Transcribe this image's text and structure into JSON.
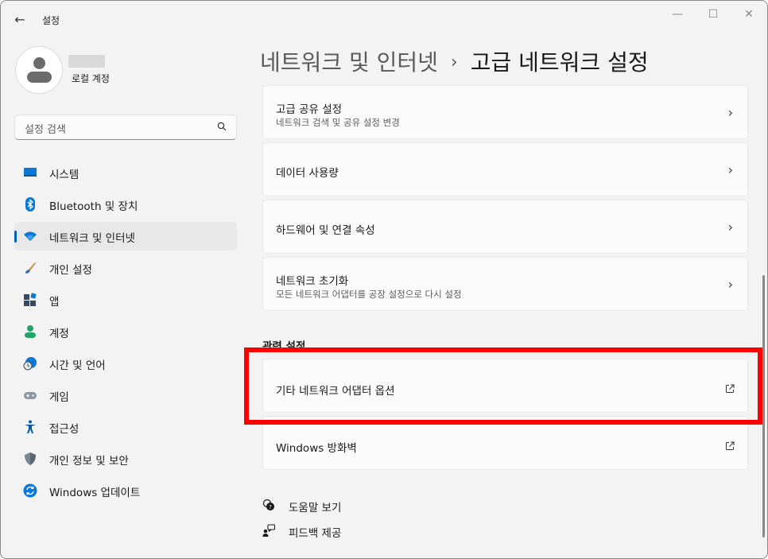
{
  "app": {
    "title": "설정"
  },
  "user": {
    "account_label": "로컬 계정"
  },
  "search": {
    "placeholder": "설정 검색"
  },
  "nav": [
    {
      "label": "시스템",
      "icon": "system-icon"
    },
    {
      "label": "Bluetooth 및 장치",
      "icon": "bluetooth-icon"
    },
    {
      "label": "네트워크 및 인터넷",
      "icon": "wifi-icon",
      "active": true
    },
    {
      "label": "개인 설정",
      "icon": "brush-icon"
    },
    {
      "label": "앱",
      "icon": "apps-icon"
    },
    {
      "label": "계정",
      "icon": "account-icon"
    },
    {
      "label": "시간 및 언어",
      "icon": "globe-clock-icon"
    },
    {
      "label": "게임",
      "icon": "gamepad-icon"
    },
    {
      "label": "접근성",
      "icon": "accessibility-icon"
    },
    {
      "label": "개인 정보 및 보안",
      "icon": "shield-icon"
    },
    {
      "label": "Windows 업데이트",
      "icon": "update-icon"
    }
  ],
  "header": {
    "parent": "네트워크 및 인터넷",
    "separator": "›",
    "current": "고급 네트워크 설정"
  },
  "cards": [
    {
      "title": "고급 공유 설정",
      "subtitle": "네트워크 검색 및 공유 설정 변경"
    },
    {
      "title": "데이터 사용량"
    },
    {
      "title": "하드웨어 및 연결 속성"
    },
    {
      "title": "네트워크 초기화",
      "subtitle": "모든 네트워크 어댑터를 공장 설정으로 다시 설정"
    }
  ],
  "related": {
    "heading": "관련 설정",
    "items": [
      {
        "title": "기타 네트워크 어댑터 옵션"
      },
      {
        "title": "Windows 방화벽"
      }
    ]
  },
  "help": {
    "get_help": "도움말 보기",
    "feedback": "피드백 제공"
  },
  "colors": {
    "accent": "#005fb8",
    "highlight": "#ff0000",
    "window_bg": "#f3f3f3",
    "card_bg": "#fbfbfb"
  }
}
